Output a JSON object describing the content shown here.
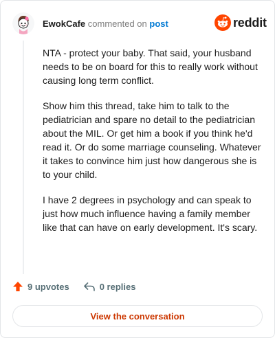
{
  "header": {
    "username": "EwokCafe",
    "action_text": "commented on",
    "link_text": "post",
    "brand": "reddit"
  },
  "comment": {
    "paragraphs": [
      "NTA - protect your baby. That said, your husband needs to be on board for this to really work without causing long term conflict.",
      "Show him this thread, take him to talk to the pediatrician and spare no detail to the pediatrician about the MIL. Or get him a book if you think he'd read it. Or do some marriage counseling. Whatever it takes to convince him just how dangerous she is to your child.",
      "I have 2 degrees in psychology and can speak to just how much influence having a family member like that can have on early development. It's scary."
    ]
  },
  "actions": {
    "upvotes": "9 upvotes",
    "replies": "0 replies"
  },
  "cta": {
    "label": "View the conversation"
  },
  "colors": {
    "brand": "#ff4500",
    "link": "#0079d3",
    "cta_text": "#cc3700",
    "muted": "#576f76"
  },
  "icons": {
    "avatar": "snoo-avatar-icon",
    "logo": "reddit-snoo-icon",
    "upvote": "upvote-arrow-icon",
    "reply": "reply-arrow-icon"
  }
}
